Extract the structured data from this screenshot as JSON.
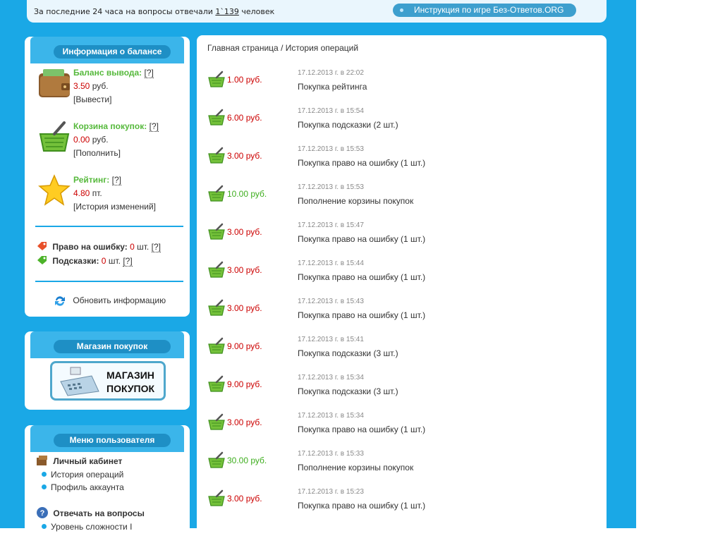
{
  "topbar": {
    "visitors_prefix": "За последние 24 часа на вопросы отвечали",
    "visitors_count": "1`139",
    "visitors_suffix": "человек",
    "howto_label": "Инструкция по игре Без-Ответов.ORG"
  },
  "balance": {
    "title": "Информация о балансе",
    "withdraw": {
      "label": "Баланс вывода:",
      "help": "[?]",
      "value": "3.50",
      "unit": "руб.",
      "action": "[Вывести]"
    },
    "basket": {
      "label": "Корзина покупок:",
      "help": "[?]",
      "value": "0.00",
      "unit": "руб.",
      "action": "[Пополнить]"
    },
    "rating": {
      "label": "Рейтинг:",
      "help": "[?]",
      "value": "4.80",
      "unit": "пт.",
      "action": "[История изменений]"
    },
    "mistake": {
      "label": "Право на ошибку:",
      "value": "0",
      "unit": "шт.",
      "help": "[?]"
    },
    "hints": {
      "label": "Подсказки:",
      "value": "0",
      "unit": "шт.",
      "help": "[?]"
    },
    "refresh_label": "Обновить информацию"
  },
  "shop": {
    "title": "Магазин покупок",
    "banner_line1": "МАГАЗИН",
    "banner_line2": "ПОКУПОК"
  },
  "user_menu": {
    "title": "Меню пользователя",
    "cabinet": "Личный кабинет",
    "history": "История операций",
    "profile": "Профиль аккаунта",
    "answer": "Отвечать на вопросы",
    "difficulty": "Уровень сложности I"
  },
  "breadcrumb": "Главная страница / История операций",
  "operations": [
    {
      "amount": "1.00 руб.",
      "color": "red",
      "date": "17.12.2013 г. в 22:02",
      "desc": "Покупка рейтинга"
    },
    {
      "amount": "6.00 руб.",
      "color": "red",
      "date": "17.12.2013 г. в 15:54",
      "desc": "Покупка подсказки (2 шт.)"
    },
    {
      "amount": "3.00 руб.",
      "color": "red",
      "date": "17.12.2013 г. в 15:53",
      "desc": "Покупка право на ошибку (1 шт.)"
    },
    {
      "amount": "10.00 руб.",
      "color": "green",
      "date": "17.12.2013 г. в 15:53",
      "desc": "Пополнение корзины покупок"
    },
    {
      "amount": "3.00 руб.",
      "color": "red",
      "date": "17.12.2013 г. в 15:47",
      "desc": "Покупка право на ошибку (1 шт.)"
    },
    {
      "amount": "3.00 руб.",
      "color": "red",
      "date": "17.12.2013 г. в 15:44",
      "desc": "Покупка право на ошибку (1 шт.)"
    },
    {
      "amount": "3.00 руб.",
      "color": "red",
      "date": "17.12.2013 г. в 15:43",
      "desc": "Покупка право на ошибку (1 шт.)"
    },
    {
      "amount": "9.00 руб.",
      "color": "red",
      "date": "17.12.2013 г. в 15:41",
      "desc": "Покупка подсказки (3 шт.)"
    },
    {
      "amount": "9.00 руб.",
      "color": "red",
      "date": "17.12.2013 г. в 15:34",
      "desc": "Покупка подсказки (3 шт.)"
    },
    {
      "amount": "3.00 руб.",
      "color": "red",
      "date": "17.12.2013 г. в 15:34",
      "desc": "Покупка право на ошибку (1 шт.)"
    },
    {
      "amount": "30.00 руб.",
      "color": "green",
      "date": "17.12.2013 г. в 15:33",
      "desc": "Пополнение корзины покупок"
    },
    {
      "amount": "3.00 руб.",
      "color": "red",
      "date": "17.12.2013 г. в 15:23",
      "desc": "Покупка право на ошибку (1 шт.)"
    }
  ],
  "colors": {
    "red": "#cc0000",
    "green": "#3fae1f",
    "page_bg": "#1aa8e6"
  }
}
